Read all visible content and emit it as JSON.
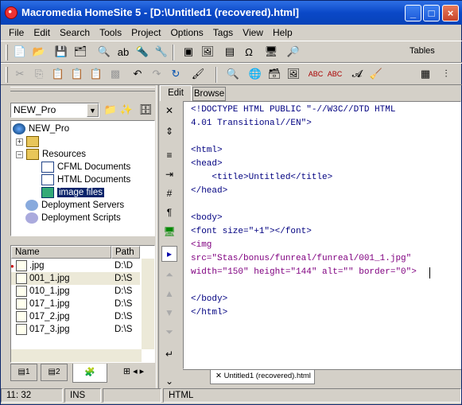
{
  "window": {
    "title": "Macromedia HomeSite 5 - [D:\\Untitled1 (recovered).html]",
    "minimize": "_",
    "maximize": "□",
    "close": "×"
  },
  "menu": [
    "File",
    "Edit",
    "Search",
    "Tools",
    "Project",
    "Options",
    "Tags",
    "View",
    "Help"
  ],
  "toolbar": {
    "tables_label": "Tables"
  },
  "left_panel": {
    "project_select": "NEW_Pro",
    "tree": {
      "root": "NEW_Pro",
      "resources": "Resources",
      "cfml": "CFML Documents",
      "html": "HTML Documents",
      "images": "image files",
      "servers": "Deployment Servers",
      "scripts": "Deployment Scripts"
    },
    "list_headers": {
      "name": "Name",
      "path": "Path"
    },
    "files": [
      {
        "name": ".jpg",
        "path": "D:\\D"
      },
      {
        "name": "001_1.jpg",
        "path": "D:\\S"
      },
      {
        "name": "010_1.jpg",
        "path": "D:\\S"
      },
      {
        "name": "017_1.jpg",
        "path": "D:\\S"
      },
      {
        "name": "017_2.jpg",
        "path": "D:\\S"
      },
      {
        "name": "017_3.jpg",
        "path": "D:\\S"
      }
    ],
    "tabs": [
      "1",
      "2"
    ]
  },
  "editor": {
    "tabs": {
      "edit": "Edit",
      "browse": "Browse"
    },
    "doc_tab": "Untitled1 (recovered).html",
    "lines": [
      "<!DOCTYPE HTML PUBLIC \"-//W3C//DTD HTML",
      "4.01 Transitional//EN\">",
      "",
      "<html>",
      "<head>",
      "    <title>Untitled</title>",
      "</head>",
      "",
      "<body>",
      "<font size=\"+1\"></font>",
      "<img",
      "src=\"Stas/bonus/funreal/funreal/001_1.jpg\"",
      "width=\"150\" height=\"144\" alt=\"\" border=\"0\">",
      "",
      "</body>",
      "</html>"
    ]
  },
  "status": {
    "position": "11: 32",
    "mode": "INS",
    "type": "HTML"
  }
}
